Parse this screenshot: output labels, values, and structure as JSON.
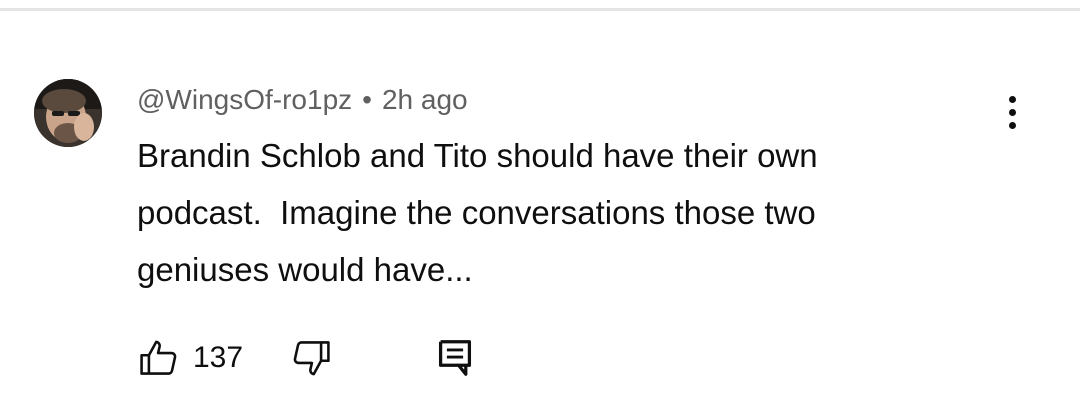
{
  "comment": {
    "author": "@WingsOf-ro1pz",
    "separator": "•",
    "timestamp": "2h ago",
    "text": "Brandin Schlob and Tito should have their own\npodcast.  Imagine the conversations those two\ngeniuses would have...",
    "like_count": "137"
  },
  "icons": {
    "avatar": "user-avatar",
    "more": "vertical-dots-icon",
    "like": "thumbs-up-icon",
    "dislike": "thumbs-down-icon",
    "reply": "reply-comment-icon"
  },
  "colors": {
    "text_primary": "#0f0f0f",
    "text_secondary": "#606060",
    "divider": "#e5e5e5",
    "background": "#ffffff"
  }
}
